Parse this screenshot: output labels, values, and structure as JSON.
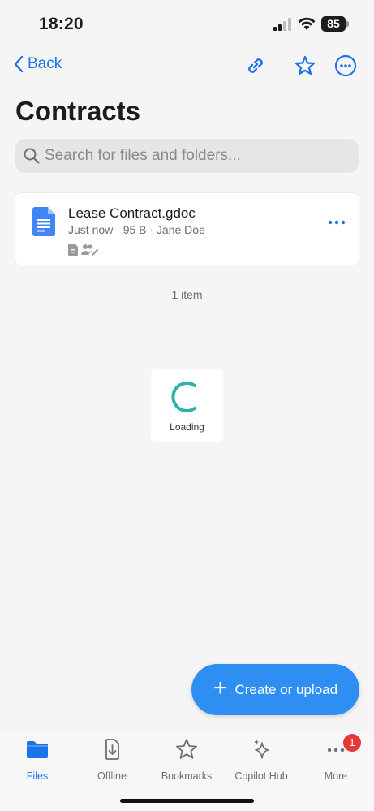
{
  "status_bar": {
    "time": "18:20",
    "battery": "85"
  },
  "nav": {
    "back_label": "Back",
    "icons": [
      "chevron-left-icon",
      "link-icon",
      "star-icon",
      "more-circle-icon"
    ]
  },
  "page": {
    "title": "Contracts"
  },
  "search": {
    "placeholder": "Search for files and folders..."
  },
  "files": [
    {
      "name": "Lease Contract.gdoc",
      "meta": "Just now · 95 B · Jane Doe",
      "icon": "google-doc-icon"
    }
  ],
  "item_count": "1 item",
  "loading": {
    "label": "Loading"
  },
  "fab": {
    "label": "Create or upload"
  },
  "tabs": [
    {
      "label": "Files",
      "icon": "folder-icon",
      "active": true
    },
    {
      "label": "Offline",
      "icon": "offline-download-icon",
      "active": false
    },
    {
      "label": "Bookmarks",
      "icon": "star-icon",
      "active": false
    },
    {
      "label": "Copilot Hub",
      "icon": "sparkle-icon",
      "active": false
    },
    {
      "label": "More",
      "icon": "more-icon",
      "active": false
    }
  ],
  "more_badge": "1",
  "colors": {
    "accent": "#1a73e8",
    "fab": "#2f8ef2",
    "badge": "#e53935",
    "spinner": "#2ab3a6"
  }
}
